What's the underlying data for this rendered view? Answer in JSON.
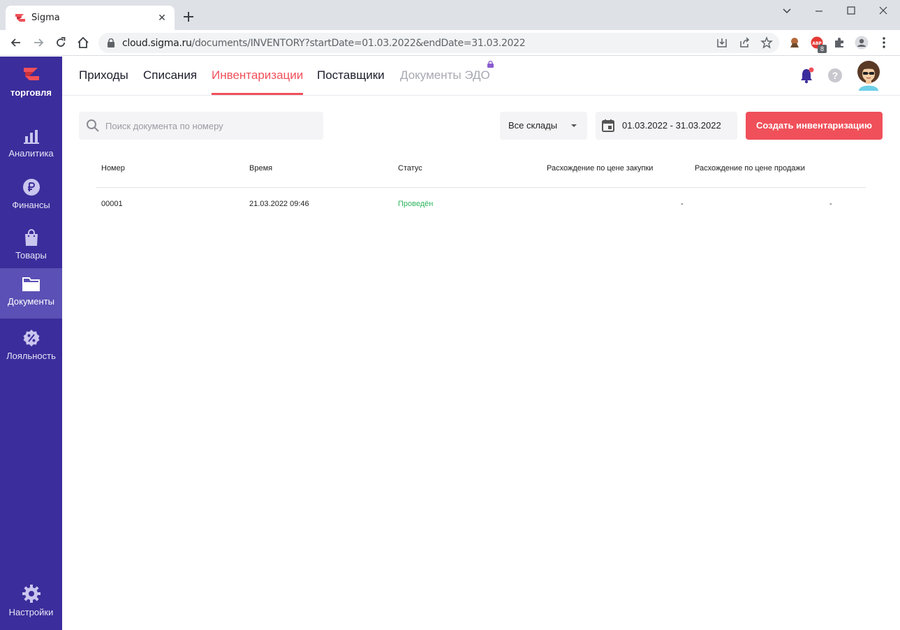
{
  "browser": {
    "tab_title": "Sigma",
    "url_host": "cloud.sigma.ru",
    "url_path": "/documents/INVENTORY?startDate=01.03.2022&endDate=31.03.2022",
    "extension_badge": "8"
  },
  "sidebar": {
    "brand": "торговля",
    "items": [
      {
        "label": "Аналитика",
        "icon": "bar-chart-icon"
      },
      {
        "label": "Финансы",
        "icon": "ruble-icon"
      },
      {
        "label": "Товары",
        "icon": "shopping-bag-icon"
      },
      {
        "label": "Документы",
        "icon": "folder-icon",
        "active": true
      },
      {
        "label": "Лояльность",
        "icon": "discount-badge-icon"
      }
    ],
    "settings_label": "Настройки"
  },
  "header": {
    "tabs": [
      {
        "label": "Приходы"
      },
      {
        "label": "Списания"
      },
      {
        "label": "Инвентаризации",
        "active": true
      },
      {
        "label": "Поставщики"
      },
      {
        "label": "Документы ЭДО",
        "disabled": true
      }
    ],
    "help_symbol": "?"
  },
  "filters": {
    "search_placeholder": "Поиск документа по номеру",
    "search_value": "",
    "warehouse": "Все склады",
    "date_range": "01.03.2022 - 31.03.2022",
    "create_button": "Создать инвентаризацию"
  },
  "table": {
    "columns": [
      "Номер",
      "Время",
      "Статус",
      "Расхождение по цене закупки",
      "Расхождение по цене продажи"
    ],
    "rows": [
      {
        "number": "00001",
        "time": "21.03.2022 09:46",
        "status": "Проведён",
        "purchase_diff": "-",
        "sale_diff": "-"
      }
    ]
  },
  "colors": {
    "sidebar": "#3b2d9b",
    "sidebar_active": "#5b50b5",
    "accent": "#f0505a",
    "status_ok": "#2db55d"
  }
}
